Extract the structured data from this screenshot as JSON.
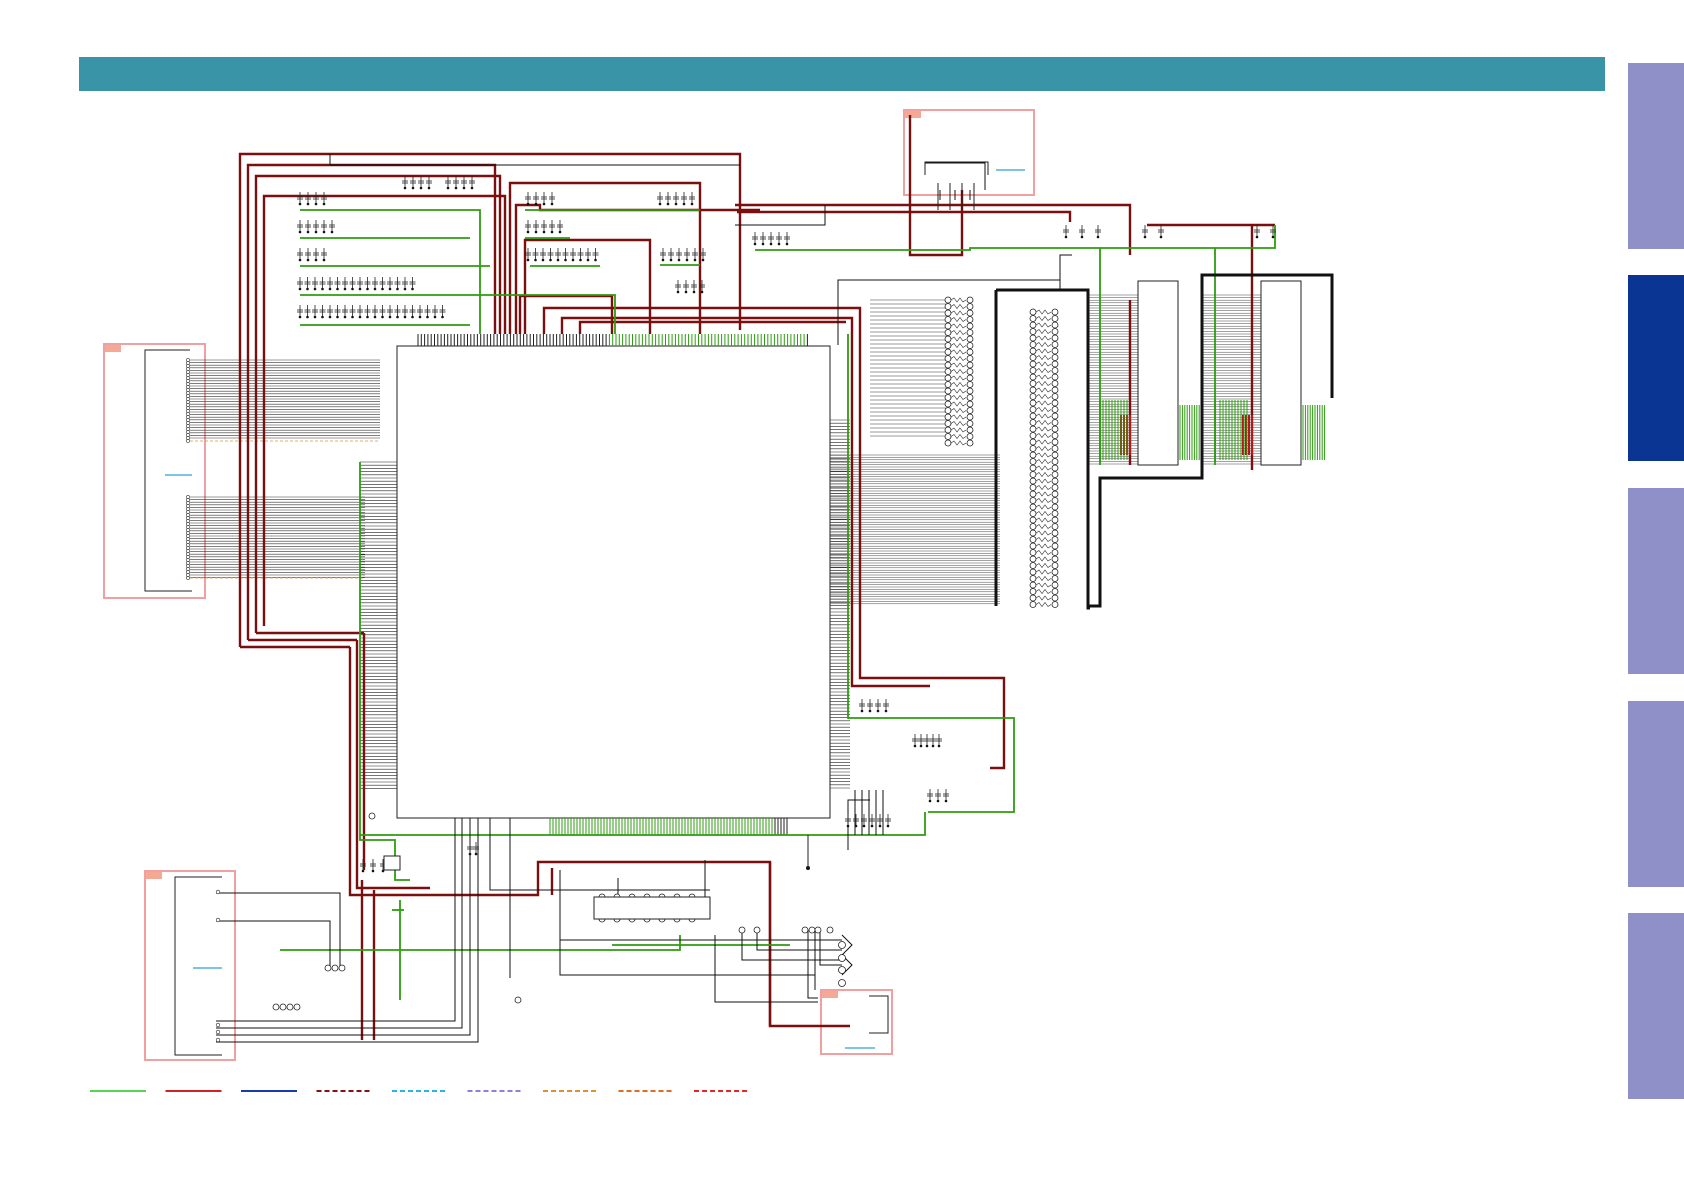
{
  "header": {
    "title": "",
    "color": "#3a94a8"
  },
  "side_tabs": [
    {
      "label": "",
      "color": "#9090c8",
      "active": false
    },
    {
      "label": "",
      "color": "#0b3593",
      "active": true
    },
    {
      "label": "",
      "color": "#9090c8",
      "active": false
    },
    {
      "label": "",
      "color": "#9090c8",
      "active": false
    },
    {
      "label": "",
      "color": "#9090c8",
      "active": false
    }
  ],
  "colors": {
    "trace_dark_red": "#7a0f0f",
    "trace_green": "#2e9c10",
    "trace_black": "#111111",
    "block_border_pink": "#f0a0a0",
    "block_tag_salmon": "#f5a994",
    "link_cyan": "#2aa0d8"
  },
  "legend": [
    {
      "color": "#55d455",
      "style": "solid"
    },
    {
      "color": "#d42020",
      "style": "solid"
    },
    {
      "color": "#1a3ab0",
      "style": "solid"
    },
    {
      "color": "#8b1010",
      "style": "dashed"
    },
    {
      "color": "#28b4e0",
      "style": "dashed"
    },
    {
      "color": "#8a80e0",
      "style": "dashed"
    },
    {
      "color": "#e09030",
      "style": "dashed"
    },
    {
      "color": "#e06a20",
      "style": "dashed"
    },
    {
      "color": "#e02a2a",
      "style": "dashed"
    }
  ]
}
